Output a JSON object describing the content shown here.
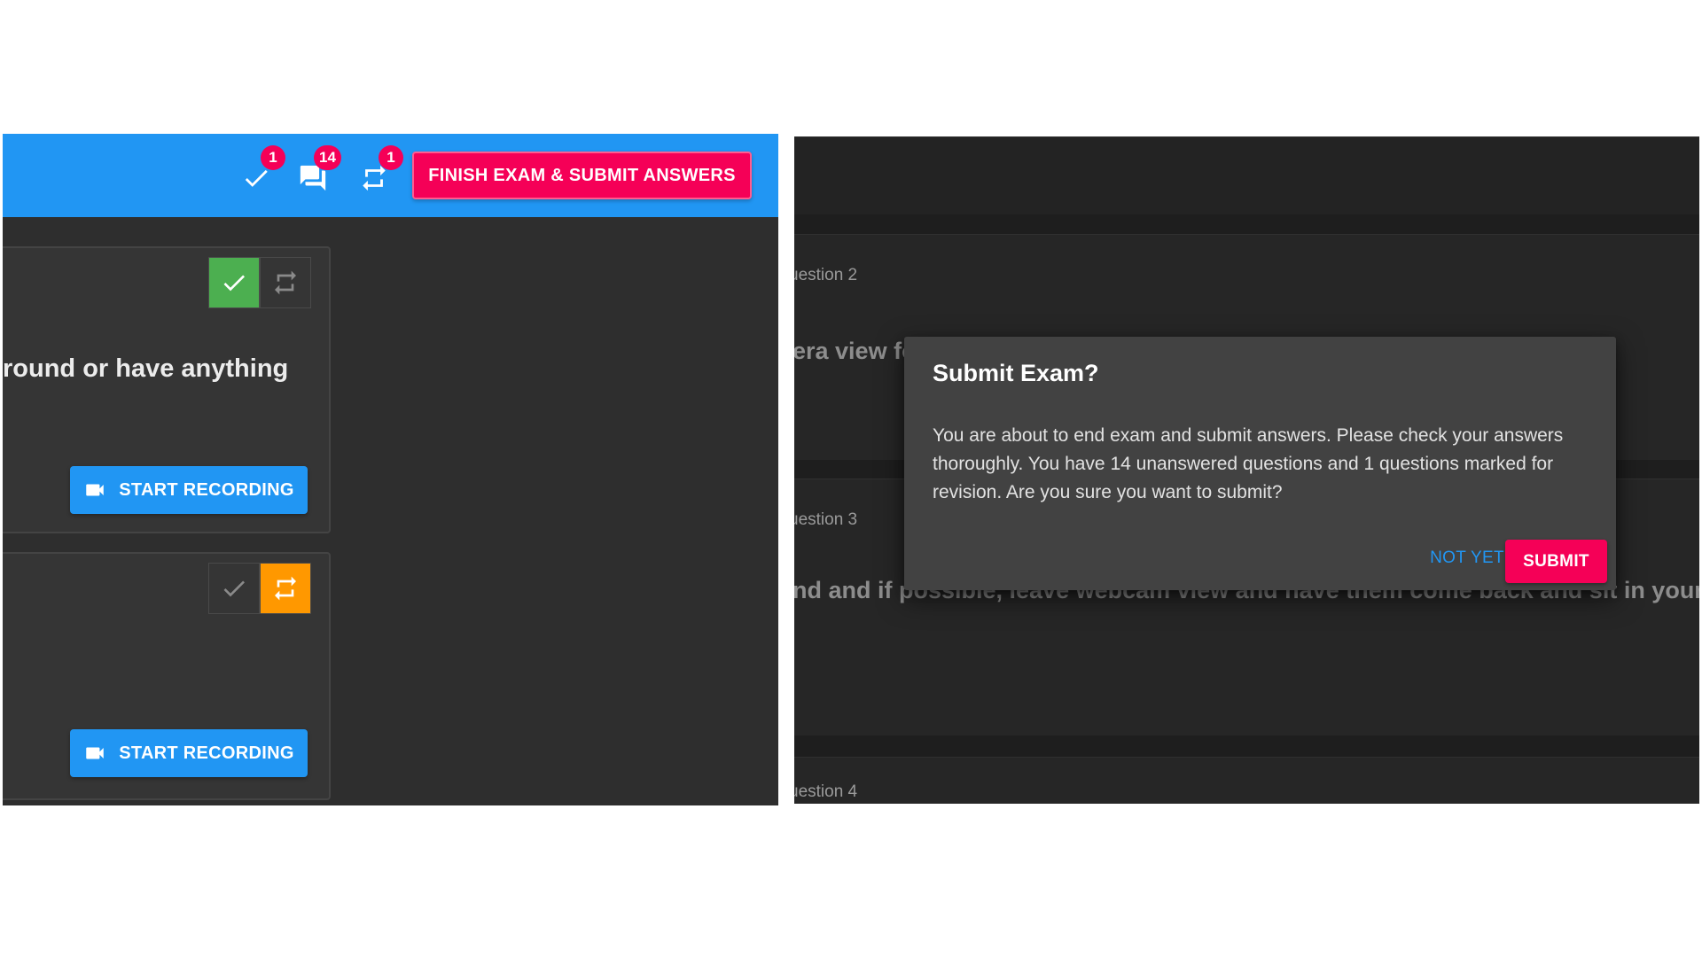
{
  "left": {
    "topbar": {
      "answered_count": "1",
      "unanswered_count": "14",
      "revision_count": "1",
      "finish_label": "FINISH EXAM & SUBMIT ANSWERS"
    },
    "question_cards": [
      {
        "text": "round or have anything",
        "answered": true,
        "marked_for_revision": false,
        "record_label": "START RECORDING"
      },
      {
        "text": "",
        "answered": false,
        "marked_for_revision": true,
        "record_label": "START RECORDING"
      }
    ]
  },
  "right": {
    "questions": [
      {
        "label": "uestion 2",
        "text": "era view fo"
      },
      {
        "label": "uestion 3",
        "text": "nd and if possible, leave webcam view and have them come back and sit in your place"
      },
      {
        "label": "uestion 4",
        "text": ""
      }
    ],
    "dialog": {
      "title": "Submit Exam?",
      "body": "You are about to end exam and submit answers. Please check your answers thoroughly. You have 14 unanswered questions and 1 questions marked for revision. Are you sure you want to submit?",
      "not_yet_label": "NOT YET",
      "submit_label": "SUBMIT"
    }
  },
  "colors": {
    "topbar_blue": "#2196f3",
    "accent_pink": "#f50057",
    "answered_green": "#4caf50",
    "revision_orange": "#ff9800",
    "panel_dark": "#2e2e2e",
    "dialog_bg": "#424242"
  },
  "icons": [
    "check-icon",
    "chat-icon",
    "repeat-icon",
    "videocam-icon"
  ]
}
